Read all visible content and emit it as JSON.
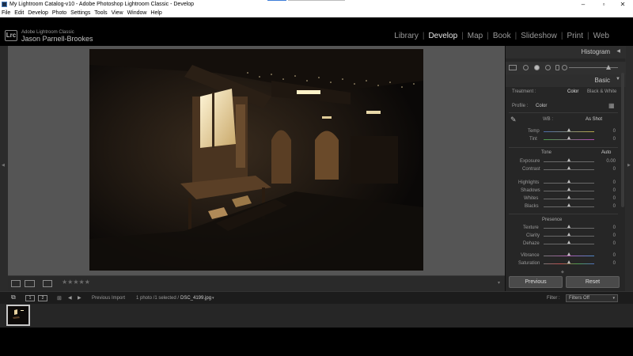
{
  "window": {
    "title": "My Lightroom Catalog-v10 - Adobe Photoshop Lightroom Classic - Develop",
    "controls": [
      "minimize-icon",
      "maximize-icon",
      "close-icon"
    ]
  },
  "menu": [
    "File",
    "Edit",
    "Develop",
    "Photo",
    "Settings",
    "Tools",
    "View",
    "Window",
    "Help"
  ],
  "identity": {
    "badge": "Lrc",
    "app_name": "Adobe Lightroom Classic",
    "user": "Jason Parnell-Brookes"
  },
  "modules": [
    "Library",
    "Develop",
    "Map",
    "Book",
    "Slideshow",
    "Print",
    "Web"
  ],
  "active_module": "Develop",
  "toolbar": {
    "stars": "★★★★★"
  },
  "panel": {
    "histogram": "Histogram",
    "basic": "Basic",
    "treatment_label": "Treatment :",
    "treatment_color": "Color",
    "treatment_bw": "Black & White",
    "profile_label": "Profile :",
    "profile_value": "Color",
    "wb_label": "WB :",
    "wb_value": "As Shot",
    "temp": {
      "label": "Temp",
      "value": "0"
    },
    "tint": {
      "label": "Tint",
      "value": "0"
    },
    "tone_title": "Tone",
    "auto": "Auto",
    "exposure": {
      "label": "Exposure",
      "value": "0.00"
    },
    "contrast": {
      "label": "Contrast",
      "value": "0"
    },
    "highlights": {
      "label": "Highlights",
      "value": "0"
    },
    "shadows": {
      "label": "Shadows",
      "value": "0"
    },
    "whites": {
      "label": "Whites",
      "value": "0"
    },
    "blacks": {
      "label": "Blacks",
      "value": "0"
    },
    "presence_title": "Presence",
    "texture": {
      "label": "Texture",
      "value": "0"
    },
    "clarity": {
      "label": "Clarity",
      "value": "0"
    },
    "dehaze": {
      "label": "Dehaze",
      "value": "0"
    },
    "vibrance": {
      "label": "Vibrance",
      "value": "0"
    },
    "saturation": {
      "label": "Saturation",
      "value": "0"
    },
    "previous": "Previous",
    "reset": "Reset"
  },
  "filmstrip_bar": {
    "page1": "1",
    "page2": "2",
    "source": "Previous Import",
    "count": "1 photo /1 selected /",
    "filename": "DSC_4199.jpg",
    "filter_label": "Filter :",
    "filter_value": "Filters Off"
  },
  "colors": {
    "background": "#000000",
    "panel": "#262626",
    "mainview": "#555555",
    "accent_blue": "#3d7dd8",
    "tint_track": "#8a6aa8",
    "temp_track": "#6f8fbf"
  }
}
